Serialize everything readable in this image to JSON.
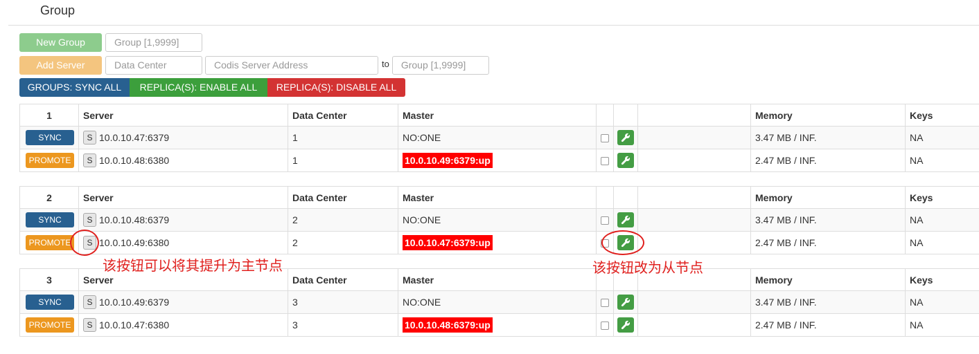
{
  "page": {
    "title": "Group"
  },
  "controls": {
    "new_group_label": "New Group",
    "group_placeholder": "Group [1,9999]",
    "add_server_label": "Add Server",
    "datacenter_placeholder": "Data Center",
    "server_addr_placeholder": "Codis Server Address",
    "to_label": "to",
    "target_group_placeholder": "Group [1,9999]"
  },
  "bulk": {
    "sync_all": "GROUPS: SYNC ALL",
    "enable_all": "REPLICA(S): ENABLE ALL",
    "disable_all": "REPLICA(S): DISABLE ALL"
  },
  "columns": {
    "server": "Server",
    "datacenter": "Data Center",
    "master": "Master",
    "memory": "Memory",
    "keys": "Keys"
  },
  "groups": [
    {
      "id": "1",
      "rows": [
        {
          "action": "SYNC",
          "s": "S",
          "addr": "10.0.10.47:6379",
          "dc": "1",
          "master": "NO:ONE",
          "master_alert": false,
          "memory": "3.47 MB / INF.",
          "keys": "NA"
        },
        {
          "action": "PROMOTE",
          "s": "S",
          "addr": "10.0.10.48:6380",
          "dc": "1",
          "master": "10.0.10.49:6379:up",
          "master_alert": true,
          "memory": "2.47 MB / INF.",
          "keys": "NA"
        }
      ]
    },
    {
      "id": "2",
      "rows": [
        {
          "action": "SYNC",
          "s": "S",
          "addr": "10.0.10.48:6379",
          "dc": "2",
          "master": "NO:ONE",
          "master_alert": false,
          "memory": "3.47 MB / INF.",
          "keys": "NA"
        },
        {
          "action": "PROMOTE",
          "s": "S",
          "addr": "10.0.10.49:6380",
          "dc": "2",
          "master": "10.0.10.47:6379:up",
          "master_alert": true,
          "memory": "2.47 MB / INF.",
          "keys": "NA"
        }
      ]
    },
    {
      "id": "3",
      "rows": [
        {
          "action": "SYNC",
          "s": "S",
          "addr": "10.0.10.49:6379",
          "dc": "3",
          "master": "NO:ONE",
          "master_alert": false,
          "memory": "3.47 MB / INF.",
          "keys": "NA"
        },
        {
          "action": "PROMOTE",
          "s": "S",
          "addr": "10.0.10.47:6380",
          "dc": "3",
          "master": "10.0.10.48:6379:up",
          "master_alert": true,
          "memory": "2.47 MB / INF.",
          "keys": "NA"
        }
      ]
    }
  ],
  "annotations": {
    "promote_note": "该按钮可以将其提升为主节点",
    "replica_note": "该按钮改为从节点"
  },
  "colors": {
    "sync": "#286090",
    "promote": "#ec971f",
    "alert": "#ff0000",
    "wrench": "#449d44",
    "annotation": "#e0201e"
  },
  "icons": {
    "wrench": "wrench-icon",
    "checkbox": "checkbox-icon"
  }
}
